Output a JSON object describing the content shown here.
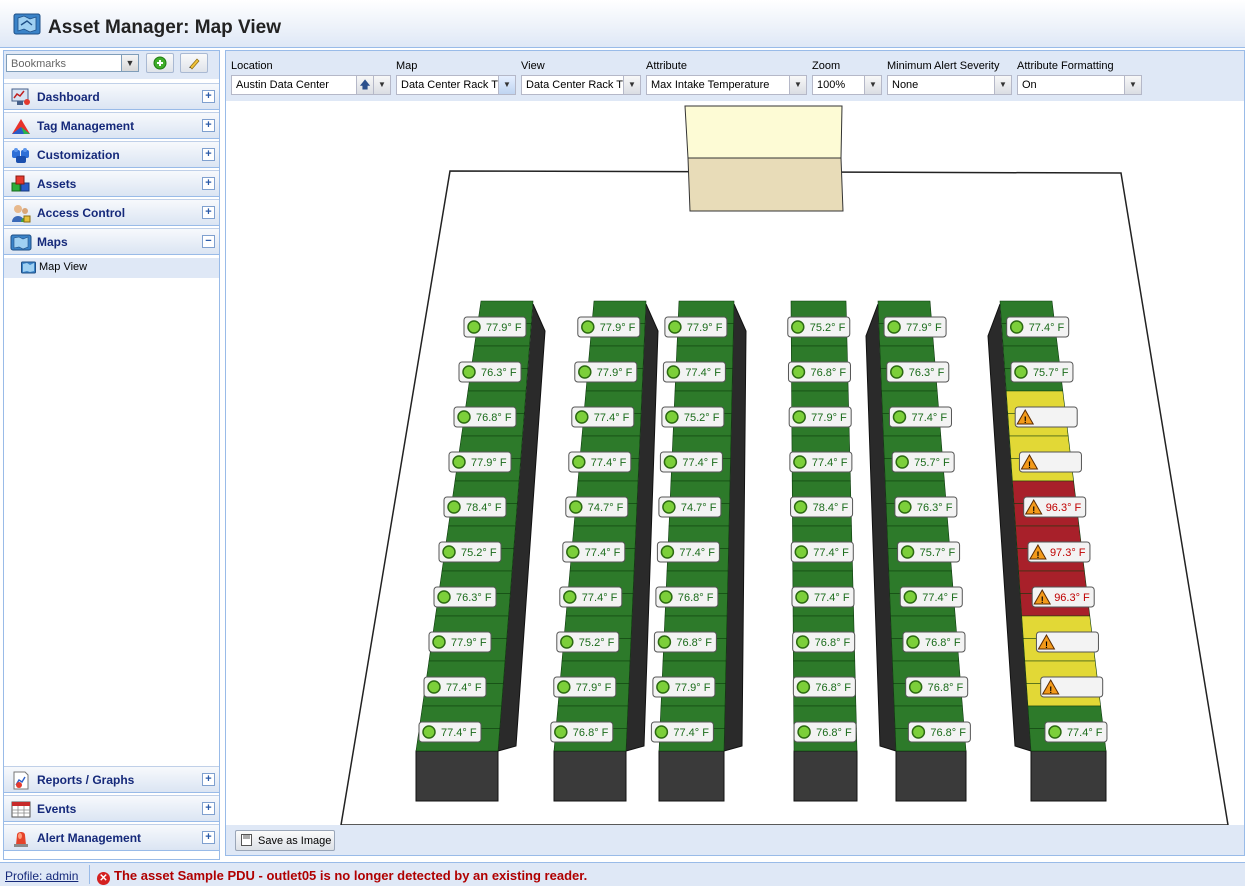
{
  "app": {
    "title": "Asset Manager: Map View"
  },
  "sidebar": {
    "bookmarks_placeholder": "Bookmarks",
    "items": [
      {
        "label": "Dashboard",
        "icon": "dashboard-icon",
        "toggle": "+"
      },
      {
        "label": "Tag Management",
        "icon": "tag-icon",
        "toggle": "+"
      },
      {
        "label": "Customization",
        "icon": "customization-icon",
        "toggle": "+"
      },
      {
        "label": "Assets",
        "icon": "assets-icon",
        "toggle": "+"
      },
      {
        "label": "Access Control",
        "icon": "access-control-icon",
        "toggle": "+"
      },
      {
        "label": "Maps",
        "icon": "maps-icon",
        "toggle": "−"
      }
    ],
    "sub_item": {
      "label": "Map View",
      "icon": "map-view-icon"
    },
    "bottom_items": [
      {
        "label": "Reports / Graphs",
        "icon": "reports-icon",
        "toggle": "+"
      },
      {
        "label": "Events",
        "icon": "events-icon",
        "toggle": "+"
      },
      {
        "label": "Alert Management",
        "icon": "alert-management-icon",
        "toggle": "+"
      }
    ]
  },
  "toolbar": {
    "location": {
      "label": "Location",
      "value": "Austin Data Center"
    },
    "map": {
      "label": "Map",
      "value": "Data Center Rack T"
    },
    "view": {
      "label": "View",
      "value": "Data Center Rack T"
    },
    "attribute": {
      "label": "Attribute",
      "value": "Max Intake Temperature"
    },
    "zoom": {
      "label": "Zoom",
      "value": "100%"
    },
    "min_alert": {
      "label": "Minimum Alert Severity",
      "value": "None"
    },
    "attr_format": {
      "label": "Attribute Formatting",
      "value": "On"
    }
  },
  "map": {
    "rows": [
      {
        "readings": [
          {
            "value": "77.9° F",
            "status": "ok"
          },
          {
            "value": "76.3° F",
            "status": "ok"
          },
          {
            "value": "76.8° F",
            "status": "ok"
          },
          {
            "value": "77.9° F",
            "status": "ok"
          },
          {
            "value": "78.4° F",
            "status": "ok"
          },
          {
            "value": "75.2° F",
            "status": "ok"
          },
          {
            "value": "76.3° F",
            "status": "ok"
          },
          {
            "value": "77.9° F",
            "status": "ok"
          },
          {
            "value": "77.4° F",
            "status": "ok"
          },
          {
            "value": "77.4° F",
            "status": "ok"
          }
        ]
      },
      {
        "readings": [
          {
            "value": "77.9° F",
            "status": "ok"
          },
          {
            "value": "77.9° F",
            "status": "ok"
          },
          {
            "value": "77.4° F",
            "status": "ok"
          },
          {
            "value": "77.4° F",
            "status": "ok"
          },
          {
            "value": "74.7° F",
            "status": "ok"
          },
          {
            "value": "77.4° F",
            "status": "ok"
          },
          {
            "value": "77.4° F",
            "status": "ok"
          },
          {
            "value": "75.2° F",
            "status": "ok"
          },
          {
            "value": "77.9° F",
            "status": "ok"
          },
          {
            "value": "76.8° F",
            "status": "ok"
          }
        ]
      },
      {
        "readings": [
          {
            "value": "77.9° F",
            "status": "ok"
          },
          {
            "value": "77.4° F",
            "status": "ok"
          },
          {
            "value": "75.2° F",
            "status": "ok"
          },
          {
            "value": "77.4° F",
            "status": "ok"
          },
          {
            "value": "74.7° F",
            "status": "ok"
          },
          {
            "value": "77.4° F",
            "status": "ok"
          },
          {
            "value": "76.8° F",
            "status": "ok"
          },
          {
            "value": "76.8° F",
            "status": "ok"
          },
          {
            "value": "77.9° F",
            "status": "ok"
          },
          {
            "value": "77.4° F",
            "status": "ok"
          }
        ]
      },
      {
        "readings": [
          {
            "value": "75.2° F",
            "status": "ok"
          },
          {
            "value": "76.8° F",
            "status": "ok"
          },
          {
            "value": "77.9° F",
            "status": "ok"
          },
          {
            "value": "77.4° F",
            "status": "ok"
          },
          {
            "value": "78.4° F",
            "status": "ok"
          },
          {
            "value": "77.4° F",
            "status": "ok"
          },
          {
            "value": "77.4° F",
            "status": "ok"
          },
          {
            "value": "76.8° F",
            "status": "ok"
          },
          {
            "value": "76.8° F",
            "status": "ok"
          },
          {
            "value": "76.8° F",
            "status": "ok"
          }
        ]
      },
      {
        "readings": [
          {
            "value": "77.9° F",
            "status": "ok"
          },
          {
            "value": "76.3° F",
            "status": "ok"
          },
          {
            "value": "77.4° F",
            "status": "ok"
          },
          {
            "value": "75.7° F",
            "status": "ok"
          },
          {
            "value": "76.3° F",
            "status": "ok"
          },
          {
            "value": "75.7° F",
            "status": "ok"
          },
          {
            "value": "77.4° F",
            "status": "ok"
          },
          {
            "value": "76.8° F",
            "status": "ok"
          },
          {
            "value": "76.8° F",
            "status": "ok"
          },
          {
            "value": "76.8° F",
            "status": "ok"
          }
        ]
      },
      {
        "readings": [
          {
            "value": "77.4° F",
            "status": "ok"
          },
          {
            "value": "75.7° F",
            "status": "ok"
          },
          {
            "value": "",
            "status": "warning"
          },
          {
            "value": "",
            "status": "warning"
          },
          {
            "value": "96.3° F",
            "status": "critical"
          },
          {
            "value": "97.3° F",
            "status": "critical"
          },
          {
            "value": "96.3° F",
            "status": "critical"
          },
          {
            "value": "",
            "status": "warning"
          },
          {
            "value": "",
            "status": "warning"
          },
          {
            "value": "77.4° F",
            "status": "ok"
          }
        ]
      }
    ],
    "colors": {
      "ok": "#2d7a2a",
      "warning": "#e2d836",
      "critical": "#a8202a",
      "ok_text": "#1a6b1a",
      "critical_text": "#c00000",
      "warning_text": "#f3e45a"
    }
  },
  "bottom": {
    "save_label": "Save as Image"
  },
  "status": {
    "profile": "Profile: admin",
    "message": "The asset Sample PDU - outlet05 is no longer detected by an existing reader."
  }
}
